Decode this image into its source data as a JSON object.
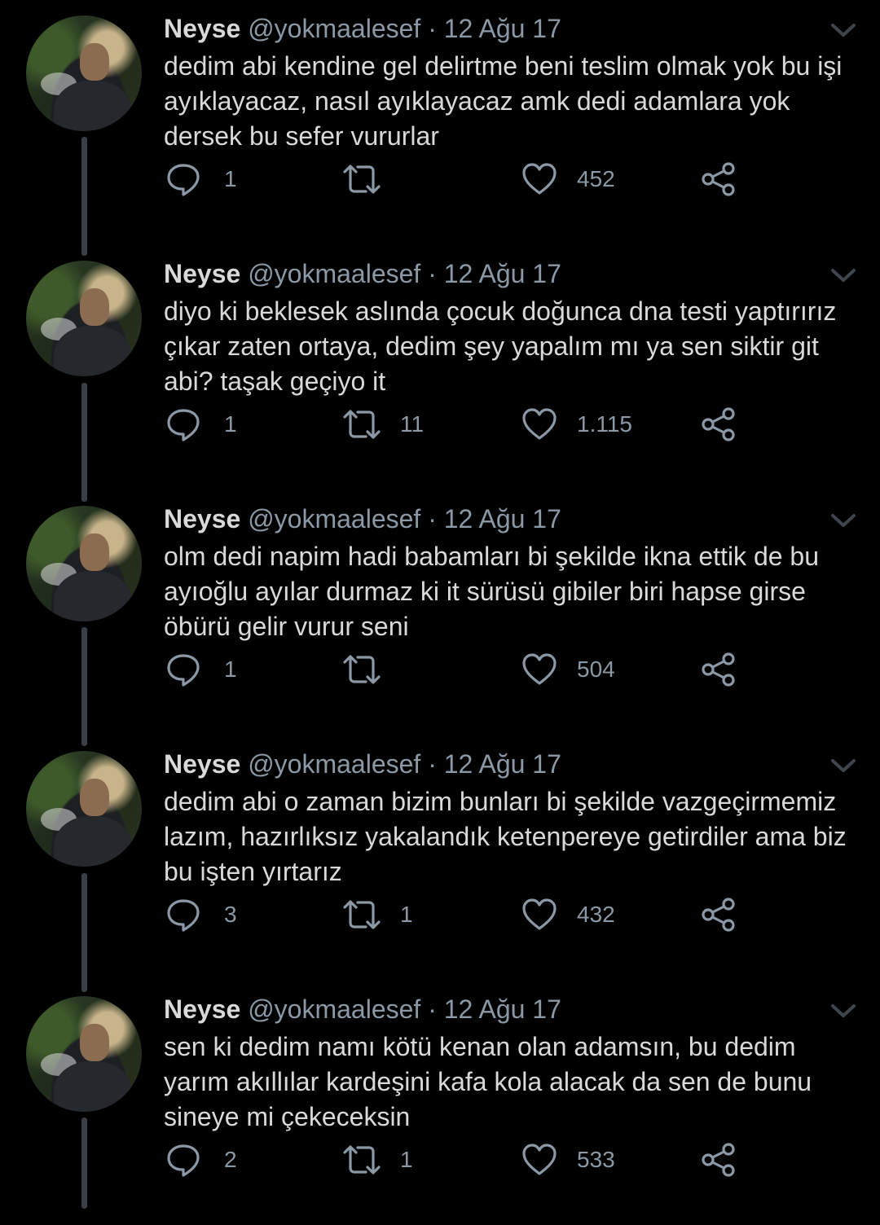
{
  "thread": {
    "tweets": [
      {
        "name": "Neyse",
        "handle": "@yokmaalesef",
        "separator": "·",
        "date": "12 Ağu 17",
        "text": "dedim abi kendine gel delirtme beni teslim olmak yok bu işi ayıklayacaz, nasıl ayıklayacaz amk dedi adamlara yok dersek bu sefer vururlar",
        "replies": "1",
        "retweets": "",
        "likes": "452"
      },
      {
        "name": "Neyse",
        "handle": "@yokmaalesef",
        "separator": "·",
        "date": "12 Ağu 17",
        "text": "diyo ki beklesek aslında çocuk doğunca dna testi yaptırırız çıkar zaten ortaya, dedim şey yapalım mı ya sen siktir git abi? taşak geçiyo it",
        "replies": "1",
        "retweets": "11",
        "likes": "1.115"
      },
      {
        "name": "Neyse",
        "handle": "@yokmaalesef",
        "separator": "·",
        "date": "12 Ağu 17",
        "text": "olm dedi napim hadi babamları bi şekilde ikna ettik de bu ayıoğlu ayılar durmaz ki it sürüsü gibiler biri hapse girse öbürü gelir vurur seni",
        "replies": "1",
        "retweets": "",
        "likes": "504"
      },
      {
        "name": "Neyse",
        "handle": "@yokmaalesef",
        "separator": "·",
        "date": "12 Ağu 17",
        "text": "dedim abi o zaman bizim bunları bi şekilde vazgeçirmemiz lazım, hazırlıksız yakalandık ketenpereye getirdiler ama biz bu işten yırtarız",
        "replies": "3",
        "retweets": "1",
        "likes": "432"
      },
      {
        "name": "Neyse",
        "handle": "@yokmaalesef",
        "separator": "·",
        "date": "12 Ağu 17",
        "text": "sen ki dedim namı kötü kenan olan adamsın, bu dedim yarım akıllılar kardeşini kafa kola alacak da sen de bunu sineye mi çekeceksin",
        "replies": "2",
        "retweets": "1",
        "likes": "533"
      }
    ]
  },
  "colors": {
    "background": "#000000",
    "text": "#d9d9d9",
    "muted": "#8b98a5",
    "thread_line": "#3a3f45"
  },
  "icons": [
    "reply-icon",
    "retweet-icon",
    "like-icon",
    "share-icon",
    "chevron-down-icon"
  ]
}
